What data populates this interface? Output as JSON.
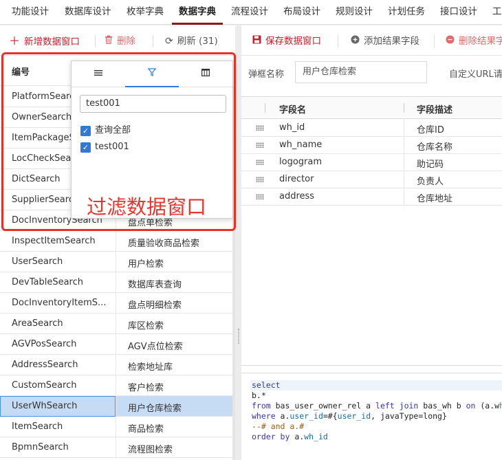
{
  "nav": {
    "tabs": [
      "功能设计",
      "数据库设计",
      "枚举字典",
      "数据字典",
      "流程设计",
      "布局设计",
      "规则设计",
      "计划任务",
      "接口设计",
      "工"
    ],
    "active_index": 3
  },
  "left_toolbar": {
    "add_label": "新增数据窗口",
    "delete_label": "删除",
    "refresh_label": "刷新 (31)"
  },
  "left_list": {
    "col_code_header": "编号",
    "rows": [
      {
        "code": "PlatformSearch",
        "name": ""
      },
      {
        "code": "OwnerSearch",
        "name": ""
      },
      {
        "code": "ItemPackageSearch",
        "name": ""
      },
      {
        "code": "LocCheckSearch",
        "name": ""
      },
      {
        "code": "DictSearch",
        "name": ""
      },
      {
        "code": "SupplierSearch",
        "name": ""
      },
      {
        "code": "DocInventorySearch",
        "name": "盘点单检索"
      },
      {
        "code": "InspectItemSearch",
        "name": "质量验收商品检索"
      },
      {
        "code": "UserSearch",
        "name": "用户检索"
      },
      {
        "code": "DevTableSearch",
        "name": "数据库表查询"
      },
      {
        "code": "DocInventoryItemS...",
        "name": "盘点明细检索"
      },
      {
        "code": "AreaSearch",
        "name": "库区检索"
      },
      {
        "code": "AGVPosSearch",
        "name": "AGV点位检索"
      },
      {
        "code": "AddressSearch",
        "name": "检索地址库"
      },
      {
        "code": "CustomSearch",
        "name": "客户检索"
      },
      {
        "code": "UserWhSearch",
        "name": "用户仓库检索"
      },
      {
        "code": "ItemSearch",
        "name": "商品检索"
      },
      {
        "code": "BpmnSearch",
        "name": "流程图检索"
      }
    ],
    "selected_index": 15
  },
  "filter_popup": {
    "filter_value": "test001",
    "options": [
      {
        "label": "查询全部",
        "checked": true
      },
      {
        "label": "test001",
        "checked": true
      }
    ],
    "annotation": "过滤数据窗口"
  },
  "right_toolbar": {
    "save_label": "保存数据窗口",
    "add_field_label": "添加结果字段",
    "delete_field_label": "删除结果字"
  },
  "form": {
    "name_label": "弹框名称",
    "name_value": "用户仓库检索",
    "url_label": "自定义URL请"
  },
  "fields_grid": {
    "headers": [
      "字段名",
      "字段描述"
    ],
    "rows": [
      {
        "name": "wh_id",
        "desc": "仓库ID"
      },
      {
        "name": "wh_name",
        "desc": "仓库名称"
      },
      {
        "name": "logogram",
        "desc": "助记码"
      },
      {
        "name": "director",
        "desc": "负责人"
      },
      {
        "name": "address",
        "desc": "仓库地址"
      }
    ]
  },
  "sql": {
    "lines": [
      "select",
      "b.*",
      "from bas_user_owner_rel a left join bas_wh b on (a.wh",
      "where a.user_id=#{user_id, javaType=long}",
      "--# and a.#",
      "order by a.wh_id"
    ]
  },
  "colors": {
    "accent_blue": "#2f7ad9",
    "annotation_red": "#ec2f24",
    "save_red": "#c8202a",
    "active_tab_underline": "#8a1a1a",
    "selected_row": "#c6dcf4"
  }
}
